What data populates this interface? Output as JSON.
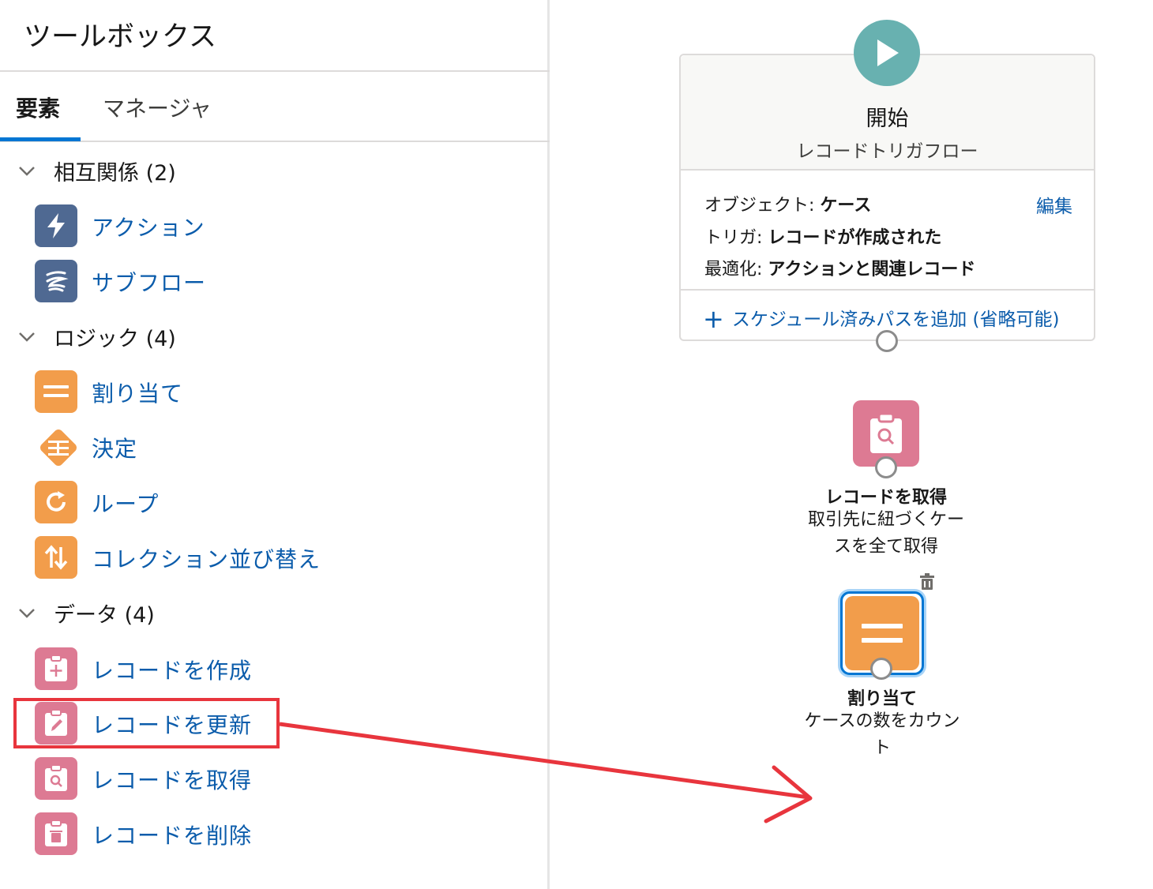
{
  "toolbox": {
    "title": "ツールボックス",
    "tabs": [
      {
        "label": "要素",
        "active": true
      },
      {
        "label": "マネージャ",
        "active": false
      }
    ],
    "sections": [
      {
        "label": "相互関係 (2)",
        "items": [
          {
            "label": "アクション",
            "icon": "lightning-icon",
            "color": "#4f6992"
          },
          {
            "label": "サブフロー",
            "icon": "subflow-icon",
            "color": "#4f6992"
          }
        ]
      },
      {
        "label": "ロジック (4)",
        "items": [
          {
            "label": "割り当て",
            "icon": "equals-icon",
            "color": "#f29d4b"
          },
          {
            "label": "決定",
            "icon": "decision-icon",
            "color": "#f29d4b"
          },
          {
            "label": "ループ",
            "icon": "loop-icon",
            "color": "#f29d4b"
          },
          {
            "label": "コレクション並び替え",
            "icon": "sort-icon",
            "color": "#f29d4b"
          }
        ]
      },
      {
        "label": "データ (4)",
        "items": [
          {
            "label": "レコードを作成",
            "icon": "record-create-icon",
            "color": "#dd7a93"
          },
          {
            "label": "レコードを更新",
            "icon": "record-update-icon",
            "color": "#dd7a93",
            "highlighted": true
          },
          {
            "label": "レコードを取得",
            "icon": "record-lookup-icon",
            "color": "#dd7a93"
          },
          {
            "label": "レコードを削除",
            "icon": "record-delete-icon",
            "color": "#dd7a93"
          }
        ]
      }
    ]
  },
  "canvas": {
    "start": {
      "title": "開始",
      "subtitle": "レコードトリガフロー",
      "edit_label": "編集",
      "props": [
        {
          "key": "オブジェクト:",
          "value": "ケース"
        },
        {
          "key": "トリガ:",
          "value": "レコードが作成された"
        },
        {
          "key": "最適化:",
          "value": "アクションと関連レコード"
        }
      ],
      "add_path_label": "スケジュール済みパスを追加 (省略可能)"
    },
    "nodes": [
      {
        "title": "レコードを取得",
        "desc_line1": "取引先に紐づくケー",
        "desc_line2": "スを全て取得",
        "icon": "record-lookup-icon",
        "color": "#dd7a93"
      },
      {
        "title": "割り当て",
        "desc_line1": "ケースの数をカウン",
        "desc_line2": "ト",
        "icon": "equals-icon",
        "color": "#f29d4b",
        "selected": true
      }
    ]
  },
  "colors": {
    "accent": "#0176d3",
    "link": "#0b5cab",
    "annotation": "#e8353d",
    "start": "#68b1b0"
  }
}
